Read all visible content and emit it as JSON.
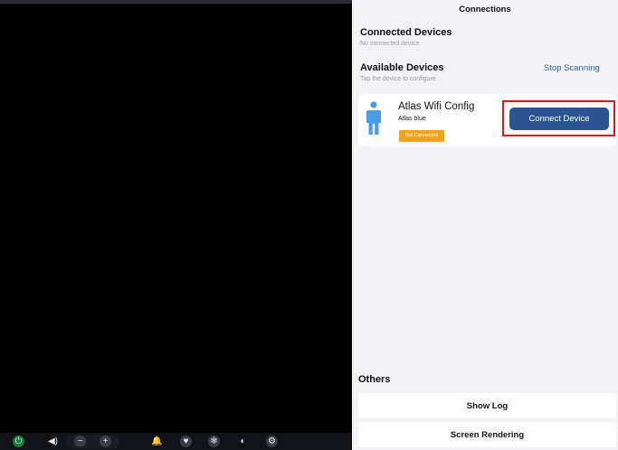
{
  "panel": {
    "title": "Connections",
    "connected": {
      "heading": "Connected Devices",
      "subtext": "No connected device"
    },
    "available": {
      "heading": "Available Devices",
      "subtext": "Tap the device to configure",
      "stop_label": "Stop Scanning"
    },
    "device": {
      "icon": "person-icon",
      "name": "Atlas Wifi Config",
      "subtitle": "Atlas blue",
      "status": "Not Connected",
      "status_color": "#f5a21b",
      "connect_label": "Connect Device",
      "connect_color": "#2a5593"
    },
    "others": {
      "heading": "Others",
      "show_log": "Show Log",
      "screen_rendering": "Screen Rendering"
    }
  },
  "toolbar": {
    "icons": [
      "power-icon",
      "volume-icon",
      "minus-icon",
      "plus-icon",
      "bell-icon",
      "heart-icon",
      "snowflake-icon",
      "contrast-icon",
      "gear-icon"
    ]
  },
  "colors": {
    "highlight": "#d7191c",
    "link": "#2c5fa0"
  }
}
